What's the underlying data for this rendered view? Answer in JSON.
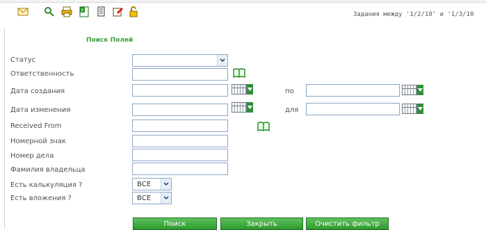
{
  "toolbar": {
    "icons": [
      "email-icon",
      "search-icon",
      "print-icon",
      "excel-icon",
      "document-icon",
      "edit-icon",
      "lock-icon"
    ],
    "tasks_text": "Задания между '1/2/10' и '1/3/10"
  },
  "form": {
    "title": "Поиск Полей",
    "fields": {
      "status": {
        "label": "Статус",
        "value": ""
      },
      "responsibility": {
        "label": "Ответственность"
      },
      "created": {
        "label": "Дата создания",
        "to_label": "по"
      },
      "modified": {
        "label": "Дата изменения",
        "to_label": "для"
      },
      "received_from": {
        "label": "Received From"
      },
      "number_mark": {
        "label": "Номерной знак"
      },
      "case_number": {
        "label": "Номер дела"
      },
      "owner_surname": {
        "label": "Фамилия владельца"
      },
      "has_calculation": {
        "label": "Есть калькуляция ?",
        "value": "ВСЕ"
      },
      "has_attachments": {
        "label": "Есть вложения ?",
        "value": "ВСЕ"
      }
    }
  },
  "buttons": {
    "search": "Поиск",
    "close": "Закрыть",
    "clear": "Очистить фильтр"
  },
  "colors": {
    "accent_green": "#3aa03a",
    "field_border": "#8aa6c8"
  }
}
